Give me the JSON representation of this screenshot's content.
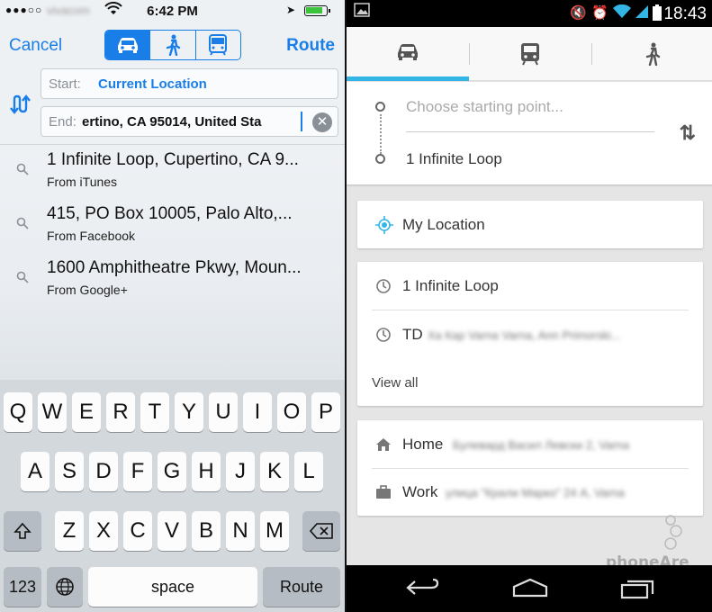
{
  "ios": {
    "status": {
      "carrier": "vivacom",
      "time": "6:42 PM",
      "signal": "●●●○○"
    },
    "nav": {
      "cancel": "Cancel",
      "route": "Route",
      "modes": [
        "car-icon",
        "walk-icon",
        "transit-icon"
      ],
      "selected_mode": "car"
    },
    "start": {
      "label": "Start:",
      "value": "Current Location"
    },
    "end": {
      "label": "End:",
      "value": "ertino, CA  95014, United Sta"
    },
    "results": [
      {
        "title": "1 Infinite Loop, Cupertino, CA 9...",
        "source": "From iTunes"
      },
      {
        "title": "415, PO Box 10005, Palo Alto,...",
        "source": "From Facebook"
      },
      {
        "title": "1600 Amphitheatre Pkwy, Moun...",
        "source": "From Google+"
      }
    ],
    "keyboard": {
      "row1": [
        "Q",
        "W",
        "E",
        "R",
        "T",
        "Y",
        "U",
        "I",
        "O",
        "P"
      ],
      "row2": [
        "A",
        "S",
        "D",
        "F",
        "G",
        "H",
        "J",
        "K",
        "L"
      ],
      "row3": [
        "Z",
        "X",
        "C",
        "V",
        "B",
        "N",
        "M"
      ],
      "numbers": "123",
      "space": "space",
      "return": "Route"
    },
    "accent": "#1a7ee8"
  },
  "android": {
    "status": {
      "time": "18:43"
    },
    "modes": [
      "car-icon",
      "transit-icon",
      "walk-icon"
    ],
    "selected_mode": "car",
    "start_placeholder": "Choose starting point...",
    "destination": "1 Infinite Loop",
    "my_location": "My Location",
    "recent": [
      {
        "label": "1 Infinite Loop",
        "detail": ""
      },
      {
        "label": "TD",
        "detail": "Ха Кар Varna  Varna, Ann Primorski..."
      }
    ],
    "view_all": "View all",
    "saved": [
      {
        "label": "Home",
        "detail": "Булевард Васил Левски 2, Varna"
      },
      {
        "label": "Work",
        "detail": "улица \"Крали Марко\" 24 А, Varna"
      }
    ],
    "watermark": "phoneArena",
    "accent": "#33b5e5"
  }
}
